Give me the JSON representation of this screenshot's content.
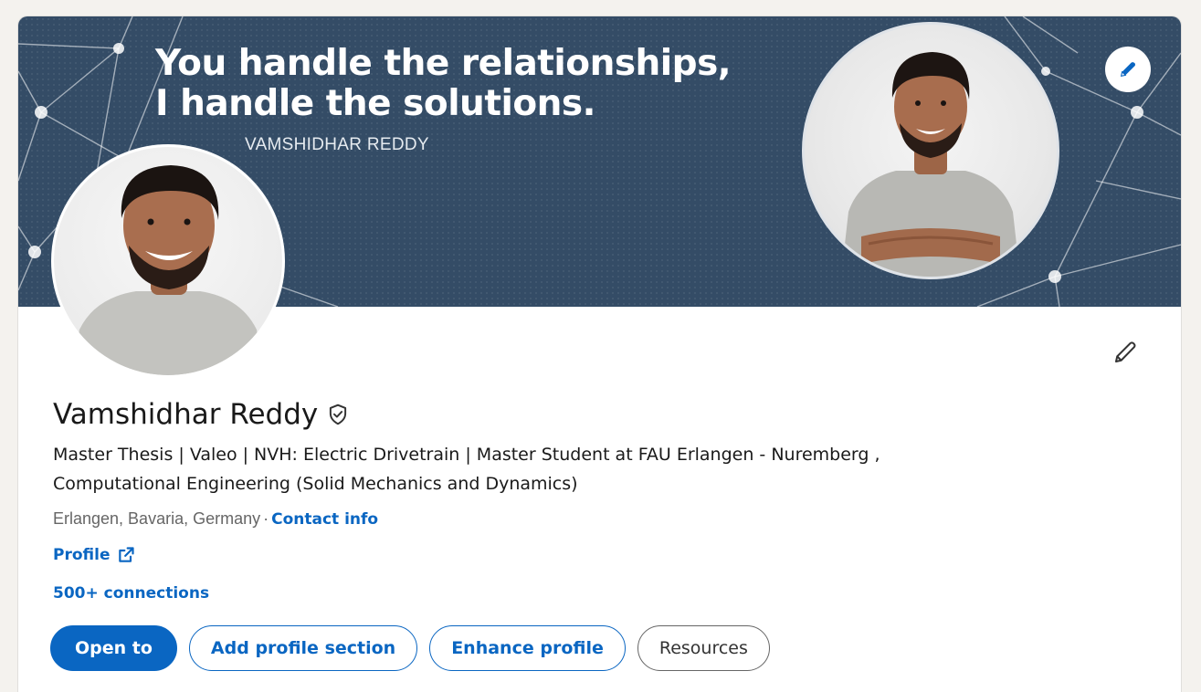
{
  "banner": {
    "title_line1": "You handle the relationships,",
    "title_line2": "I handle the solutions.",
    "subtitle": "VAMSHIDHAR REDDY",
    "background_color": "#344c66"
  },
  "profile": {
    "name": "Vamshidhar Reddy",
    "headline_line1": "Master Thesis | Valeo | NVH: Electric Drivetrain | Master Student at FAU Erlangen - Nuremberg ,",
    "headline_line2": "Computational Engineering (Solid Mechanics and Dynamics)",
    "location": "Erlangen, Bavaria, Germany",
    "separator": "·",
    "contact_info_label": "Contact info",
    "profile_link_label": "Profile",
    "connections_label": "500+ connections"
  },
  "actions": {
    "open_to": "Open to",
    "add_profile_section": "Add profile section",
    "enhance_profile": "Enhance profile",
    "resources": "Resources"
  },
  "icons": {
    "edit_banner": "pencil-icon",
    "edit_intro": "pencil-icon",
    "verified": "shield-check-icon",
    "external_link": "external-link-icon"
  },
  "colors": {
    "brand_blue": "#0a66c2",
    "text_primary": "#191919",
    "text_secondary": "#666666"
  }
}
